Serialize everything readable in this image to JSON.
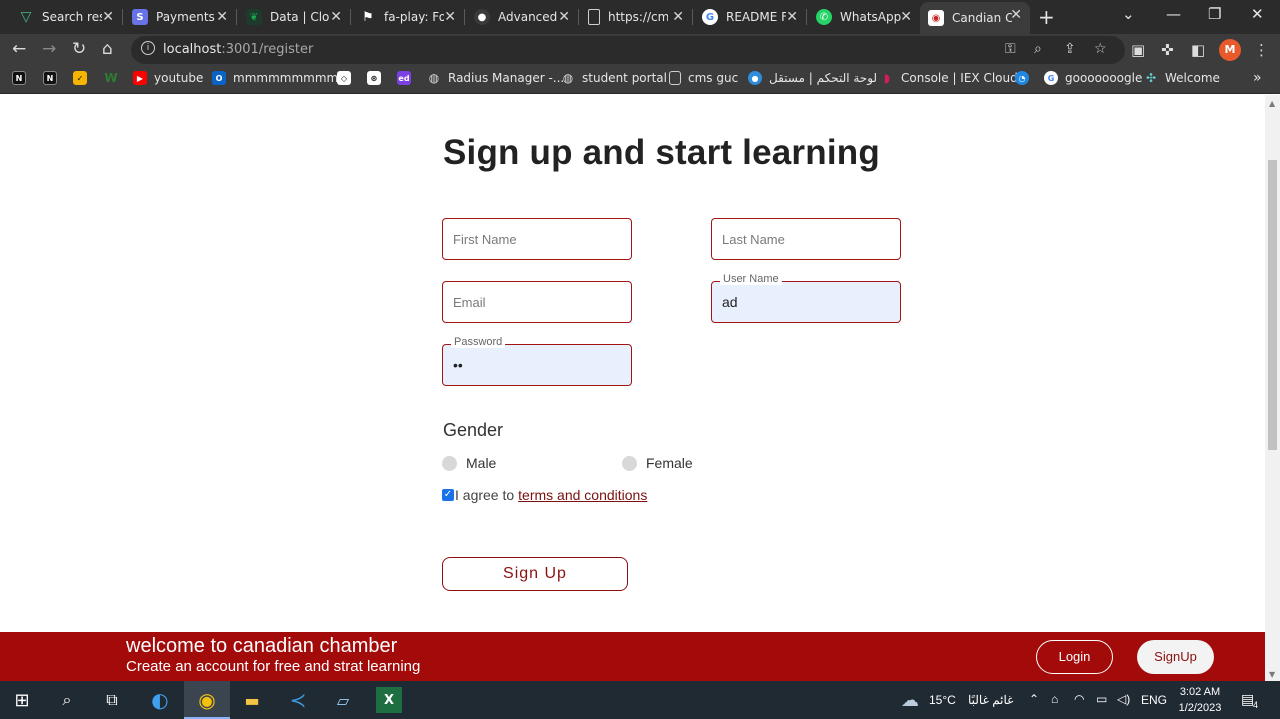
{
  "browser": {
    "tabs": [
      {
        "label": "Search res",
        "icon": "vuetify-icon",
        "color": "#41b883"
      },
      {
        "label": "Payments",
        "icon": "stripe-icon",
        "color": "#6772e5"
      },
      {
        "label": "Data | Clou",
        "icon": "mongodb-leaf-icon",
        "color": "#13aa52"
      },
      {
        "label": "fa-play: Fo",
        "icon": "flag-icon",
        "color": "#ffffff"
      },
      {
        "label": "Advanced",
        "icon": "github-icon",
        "color": "#333333"
      },
      {
        "label": "https://cm",
        "icon": "page-icon",
        "color": "#9aa0a6"
      },
      {
        "label": "README F",
        "icon": "google-icon",
        "color": "#4285f4"
      },
      {
        "label": "WhatsApp",
        "icon": "whatsapp-icon",
        "color": "#25d366"
      },
      {
        "label": "Candian C",
        "icon": "site-icon",
        "color": "#c62828"
      }
    ],
    "url_host": "localhost",
    "url_path": ":3001/register",
    "avatar_letter": "M",
    "bookmarks": [
      {
        "label": "",
        "icon": "bookmark-icon-1"
      },
      {
        "label": "",
        "icon": "bookmark-icon-2"
      },
      {
        "label": "",
        "icon": "bookmark-icon-3"
      },
      {
        "label": "",
        "icon": "bookmark-icon-4"
      },
      {
        "label": "youtube",
        "icon": "youtube-icon"
      },
      {
        "label": "mmmmmmmmm",
        "icon": "outlook-icon"
      },
      {
        "label": "",
        "icon": "codepen-icon"
      },
      {
        "label": "",
        "icon": "chatgpt-icon"
      },
      {
        "label": "",
        "icon": "edpuzzle-icon"
      },
      {
        "label": "Radius Manager -...",
        "icon": "globe-icon"
      },
      {
        "label": "student portal",
        "icon": "globe-icon"
      },
      {
        "label": "cms guc",
        "icon": "page-icon"
      },
      {
        "label": "لوحة التحكم | مستقل",
        "icon": "mostaql-icon"
      },
      {
        "label": "Console | IEX Cloud",
        "icon": "iex-icon"
      },
      {
        "label": "",
        "icon": "circle-icon"
      },
      {
        "label": "gooooooogle",
        "icon": "google-icon"
      },
      {
        "label": "Welcome",
        "icon": "welcome-icon"
      }
    ]
  },
  "form": {
    "title": "Sign up and start learning",
    "first_name_placeholder": "First Name",
    "last_name_placeholder": "Last Name",
    "email_placeholder": "Email",
    "username_label": "User Name",
    "username_value": "ad",
    "password_label": "Password",
    "password_value": "••",
    "gender_title": "Gender",
    "gender_male": "Male",
    "gender_female": "Female",
    "agree_text": "I agree to",
    "terms_link": "terms and conditions",
    "submit_label": "Sign Up"
  },
  "footer": {
    "title": "welcome to canadian chamber",
    "subtitle": "Create an account for free and strat learning",
    "login_label": "Login",
    "signup_label": "SignUp",
    "brand_color": "#a30a0a"
  },
  "taskbar": {
    "weather_temp": "15°C",
    "weather_text": "غائم غالبًا",
    "language": "ENG",
    "time": "3:02 AM",
    "date": "1/2/2023",
    "notification_count": "4"
  }
}
